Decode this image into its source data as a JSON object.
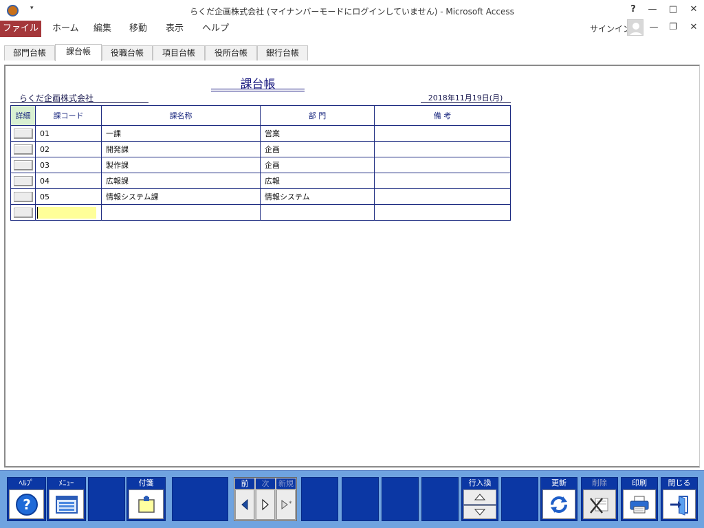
{
  "window": {
    "title": "らくだ企画株式会社 (マイナンバーモードにログインしていません) - Microsoft Access",
    "help_glyph": "?"
  },
  "menu": {
    "file": "ファイル",
    "items": [
      "ホーム",
      "編集",
      "移動",
      "表示",
      "ヘルプ"
    ],
    "signin": "サインイン"
  },
  "tabs": [
    {
      "label": "部門台帳",
      "active": false
    },
    {
      "label": "課台帳",
      "active": true
    },
    {
      "label": "役職台帳",
      "active": false
    },
    {
      "label": "項目台帳",
      "active": false
    },
    {
      "label": "役所台帳",
      "active": false
    },
    {
      "label": "銀行台帳",
      "active": false
    }
  ],
  "form": {
    "title": "課台帳",
    "company": "らくだ企画株式会社",
    "date": "2018年11月19日(月)",
    "columns": {
      "detail": "詳細",
      "code": "課コード",
      "name": "課名称",
      "dept": "部 門",
      "note": "備 考"
    },
    "rows": [
      {
        "code": "01",
        "name": "一課",
        "dept": "営業",
        "note": ""
      },
      {
        "code": "02",
        "name": "開発課",
        "dept": "企画",
        "note": ""
      },
      {
        "code": "03",
        "name": "製作課",
        "dept": "企画",
        "note": ""
      },
      {
        "code": "04",
        "name": "広報課",
        "dept": "広報",
        "note": ""
      },
      {
        "code": "05",
        "name": "情報システム課",
        "dept": "情報システム",
        "note": ""
      }
    ]
  },
  "toolbar": {
    "help": "ﾍﾙﾌﾟ",
    "menu": "ﾒﾆｭｰ",
    "sticky": "付箋",
    "prev": "前",
    "next": "次",
    "new": "新規",
    "row_swap": "行入換",
    "update": "更新",
    "delete": "削除",
    "print": "印刷",
    "close": "閉じる"
  },
  "colors": {
    "file_menu": "#a4373a",
    "toolbar_bg": "#6fa3e0",
    "toolbar_box": "#0b37a4",
    "grid_border": "#1c2a80",
    "new_row_input": "#ffff99",
    "detail_header": "#d9f0d2"
  }
}
